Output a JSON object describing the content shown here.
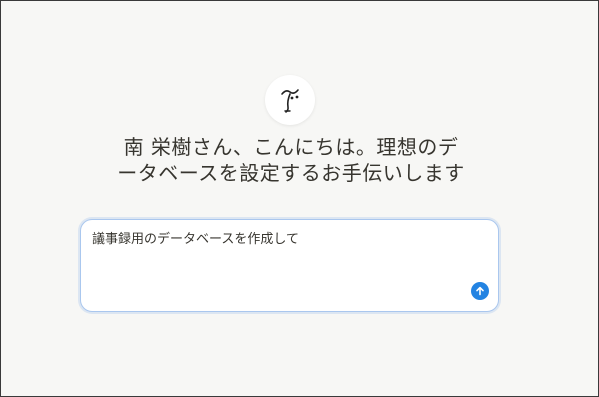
{
  "greeting": {
    "line1": "南 栄樹さん、こんにちは。理想のデ",
    "line2": "ータベースを設定するお手伝いします"
  },
  "prompt": {
    "value": "議事録用のデータベースを作成して"
  },
  "icons": {
    "logo": "notion-ai-face-icon",
    "send": "arrow-up-icon"
  },
  "colors": {
    "accent": "#2383e2",
    "input_border": "#aac7ee",
    "background": "#f7f7f5",
    "text": "#37352f"
  }
}
